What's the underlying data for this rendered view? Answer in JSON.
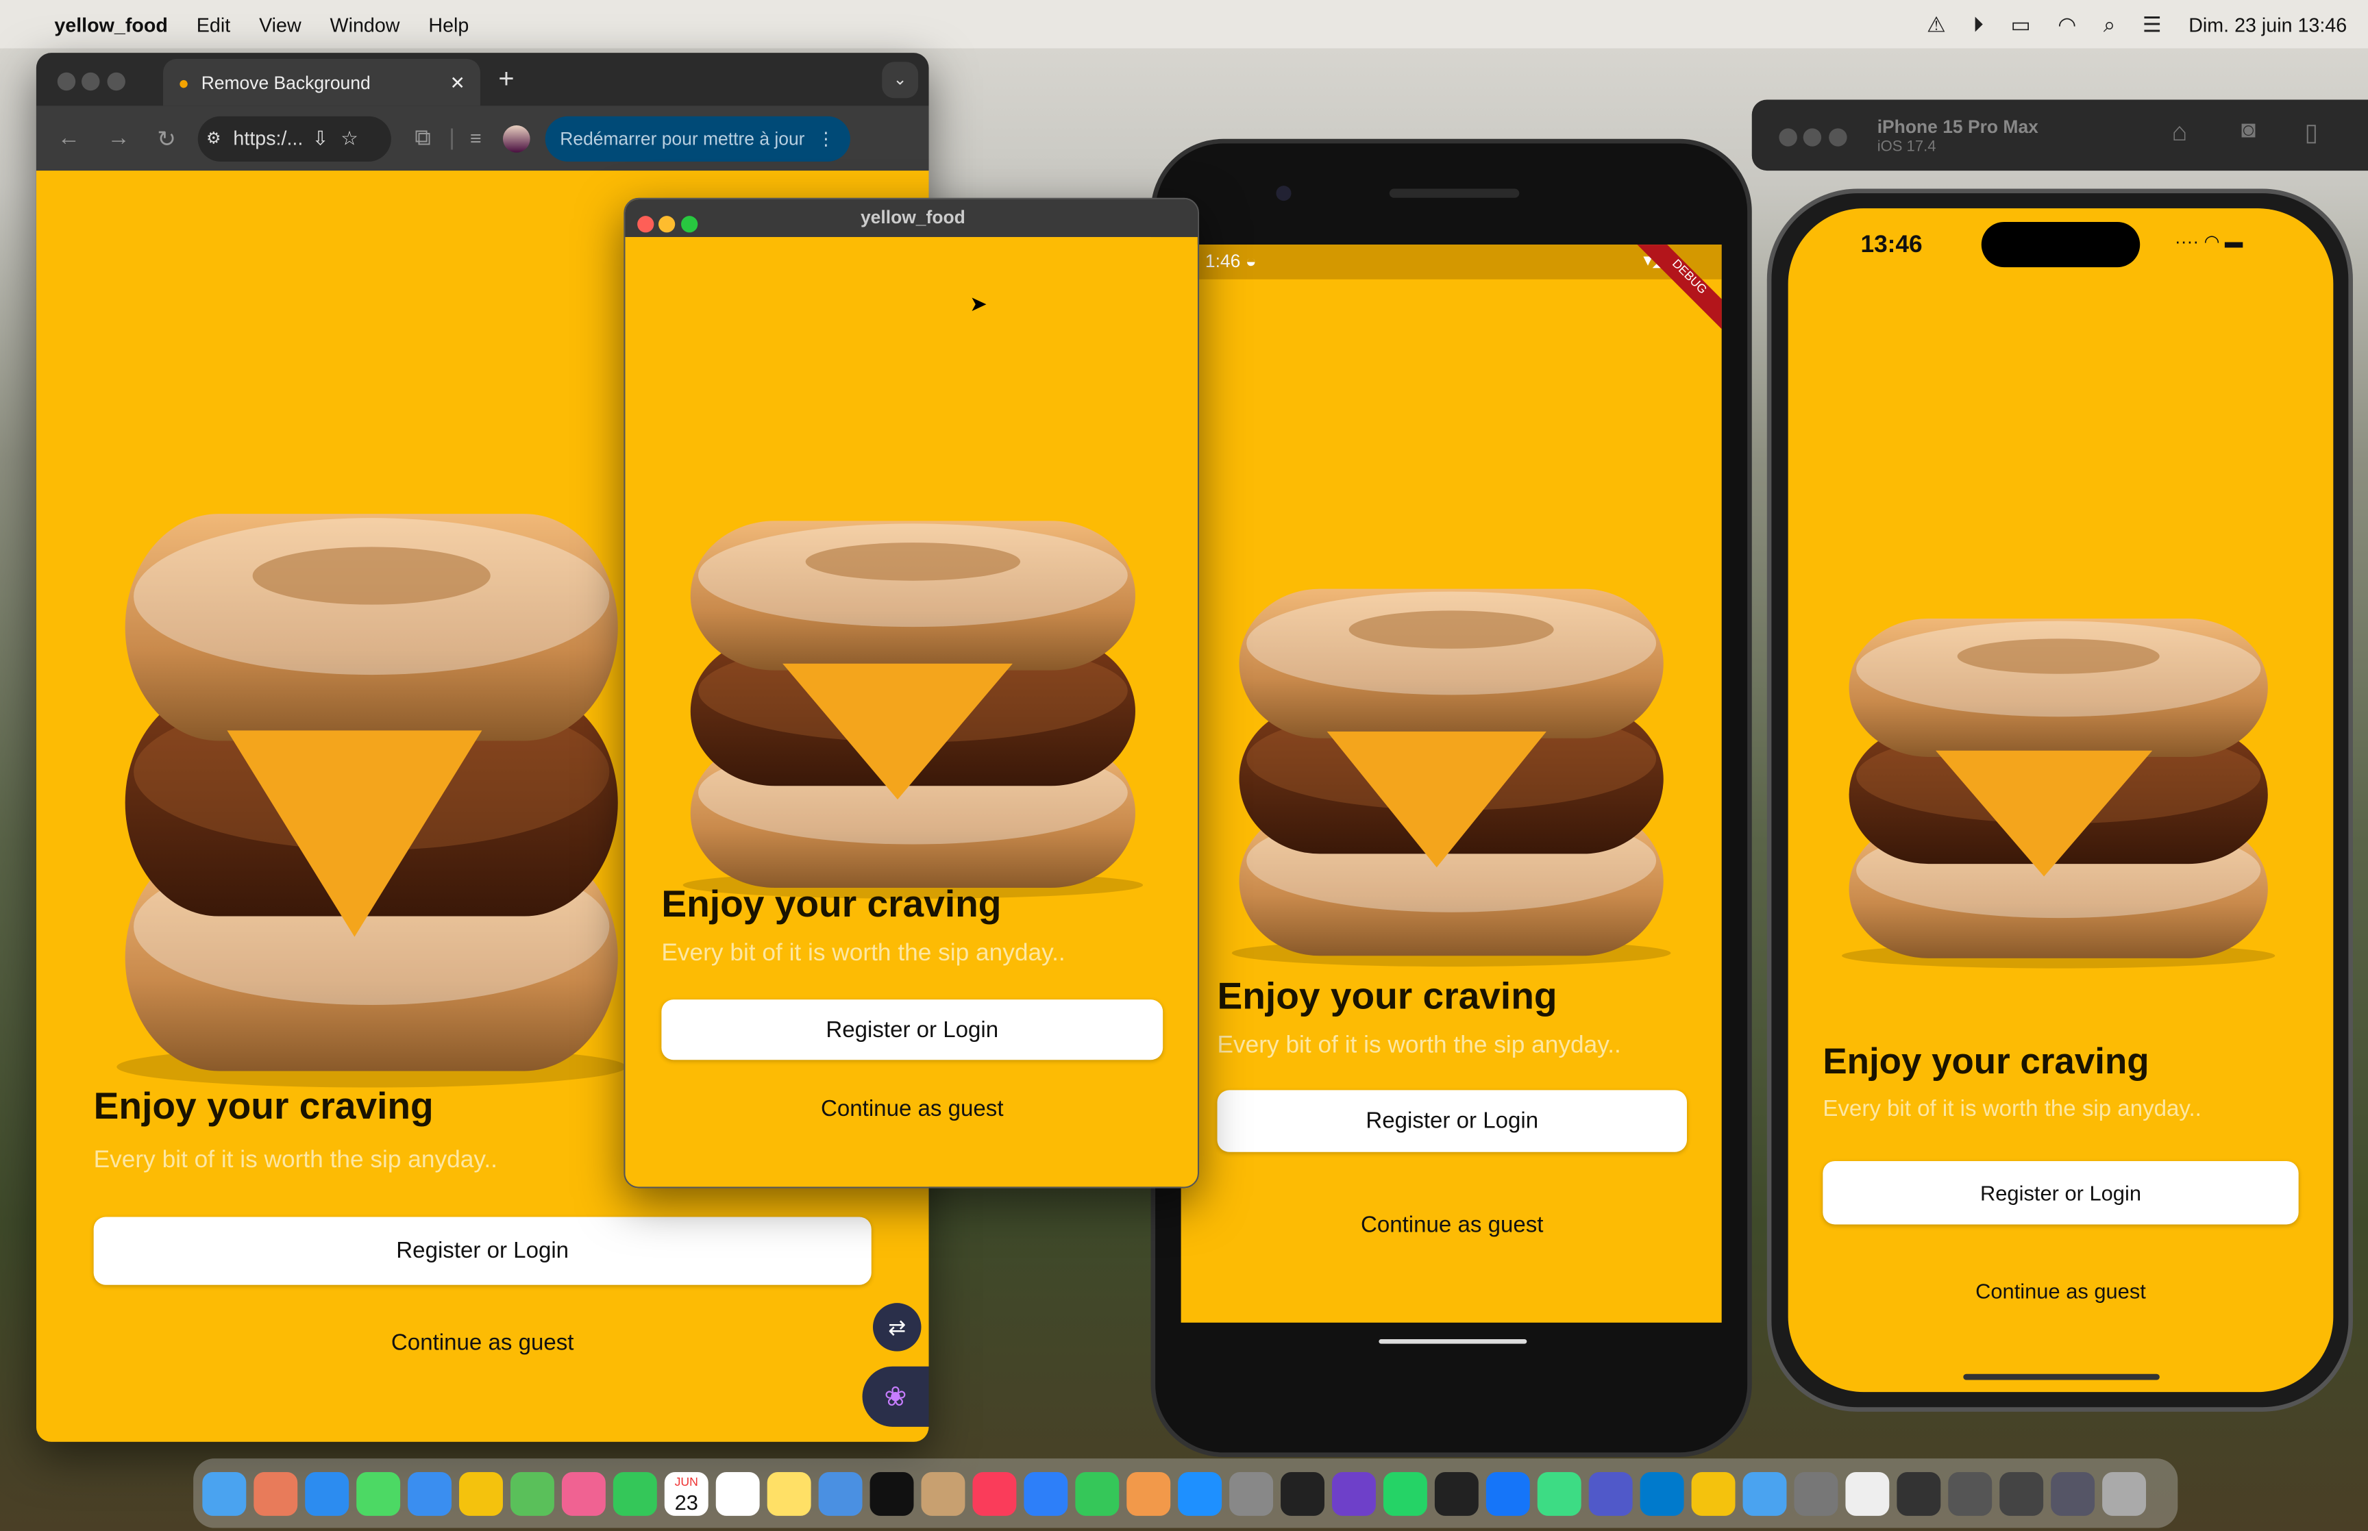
{
  "menubar": {
    "app": "yellow_food",
    "items": [
      "Edit",
      "View",
      "Window",
      "Help"
    ],
    "datetime": "Dim. 23 juin  13:46",
    "status_icons": [
      "docker-icon",
      "play-icon",
      "battery-charging-icon",
      "wifi-icon",
      "search-icon",
      "control-center-icon"
    ]
  },
  "browser": {
    "tab_title": "Remove Background",
    "url": "https:/...",
    "update_button": "Redémarrer pour mettre à jour"
  },
  "desktop_window": {
    "title": "yellow_food"
  },
  "simulator": {
    "device": "iPhone 15 Pro Max",
    "os": "iOS 17.4"
  },
  "android": {
    "time": "1:46",
    "debug_banner": "DEBUG"
  },
  "ios": {
    "time": "13:46"
  },
  "app": {
    "heading": "Enjoy your craving",
    "subtitle": "Every bit of it is worth the sip anyday..",
    "primary_button": "Register or Login",
    "secondary_button": "Continue as guest"
  },
  "colors": {
    "app_background": "#FDBB04",
    "button": "#FFFFFF",
    "update_button": "#004a77"
  },
  "dock": {
    "calendar_month": "JUN",
    "calendar_day": "23",
    "apps": [
      "finder",
      "launchpad",
      "safari",
      "messages",
      "mail",
      "chrome",
      "maps",
      "photos",
      "facetime",
      "calendar",
      "reminders",
      "notes",
      "freeform",
      "apple-tv",
      "contacts",
      "music",
      "keynote",
      "numbers",
      "pages",
      "app-store",
      "system-settings",
      "terminal",
      "github-desktop",
      "whatsapp",
      "activity-monitor",
      "xcode",
      "android-studio",
      "teams",
      "vscode",
      "flutter-app",
      "downloads",
      "help",
      "document",
      "window1",
      "window2",
      "window3",
      "window4",
      "trash"
    ]
  }
}
